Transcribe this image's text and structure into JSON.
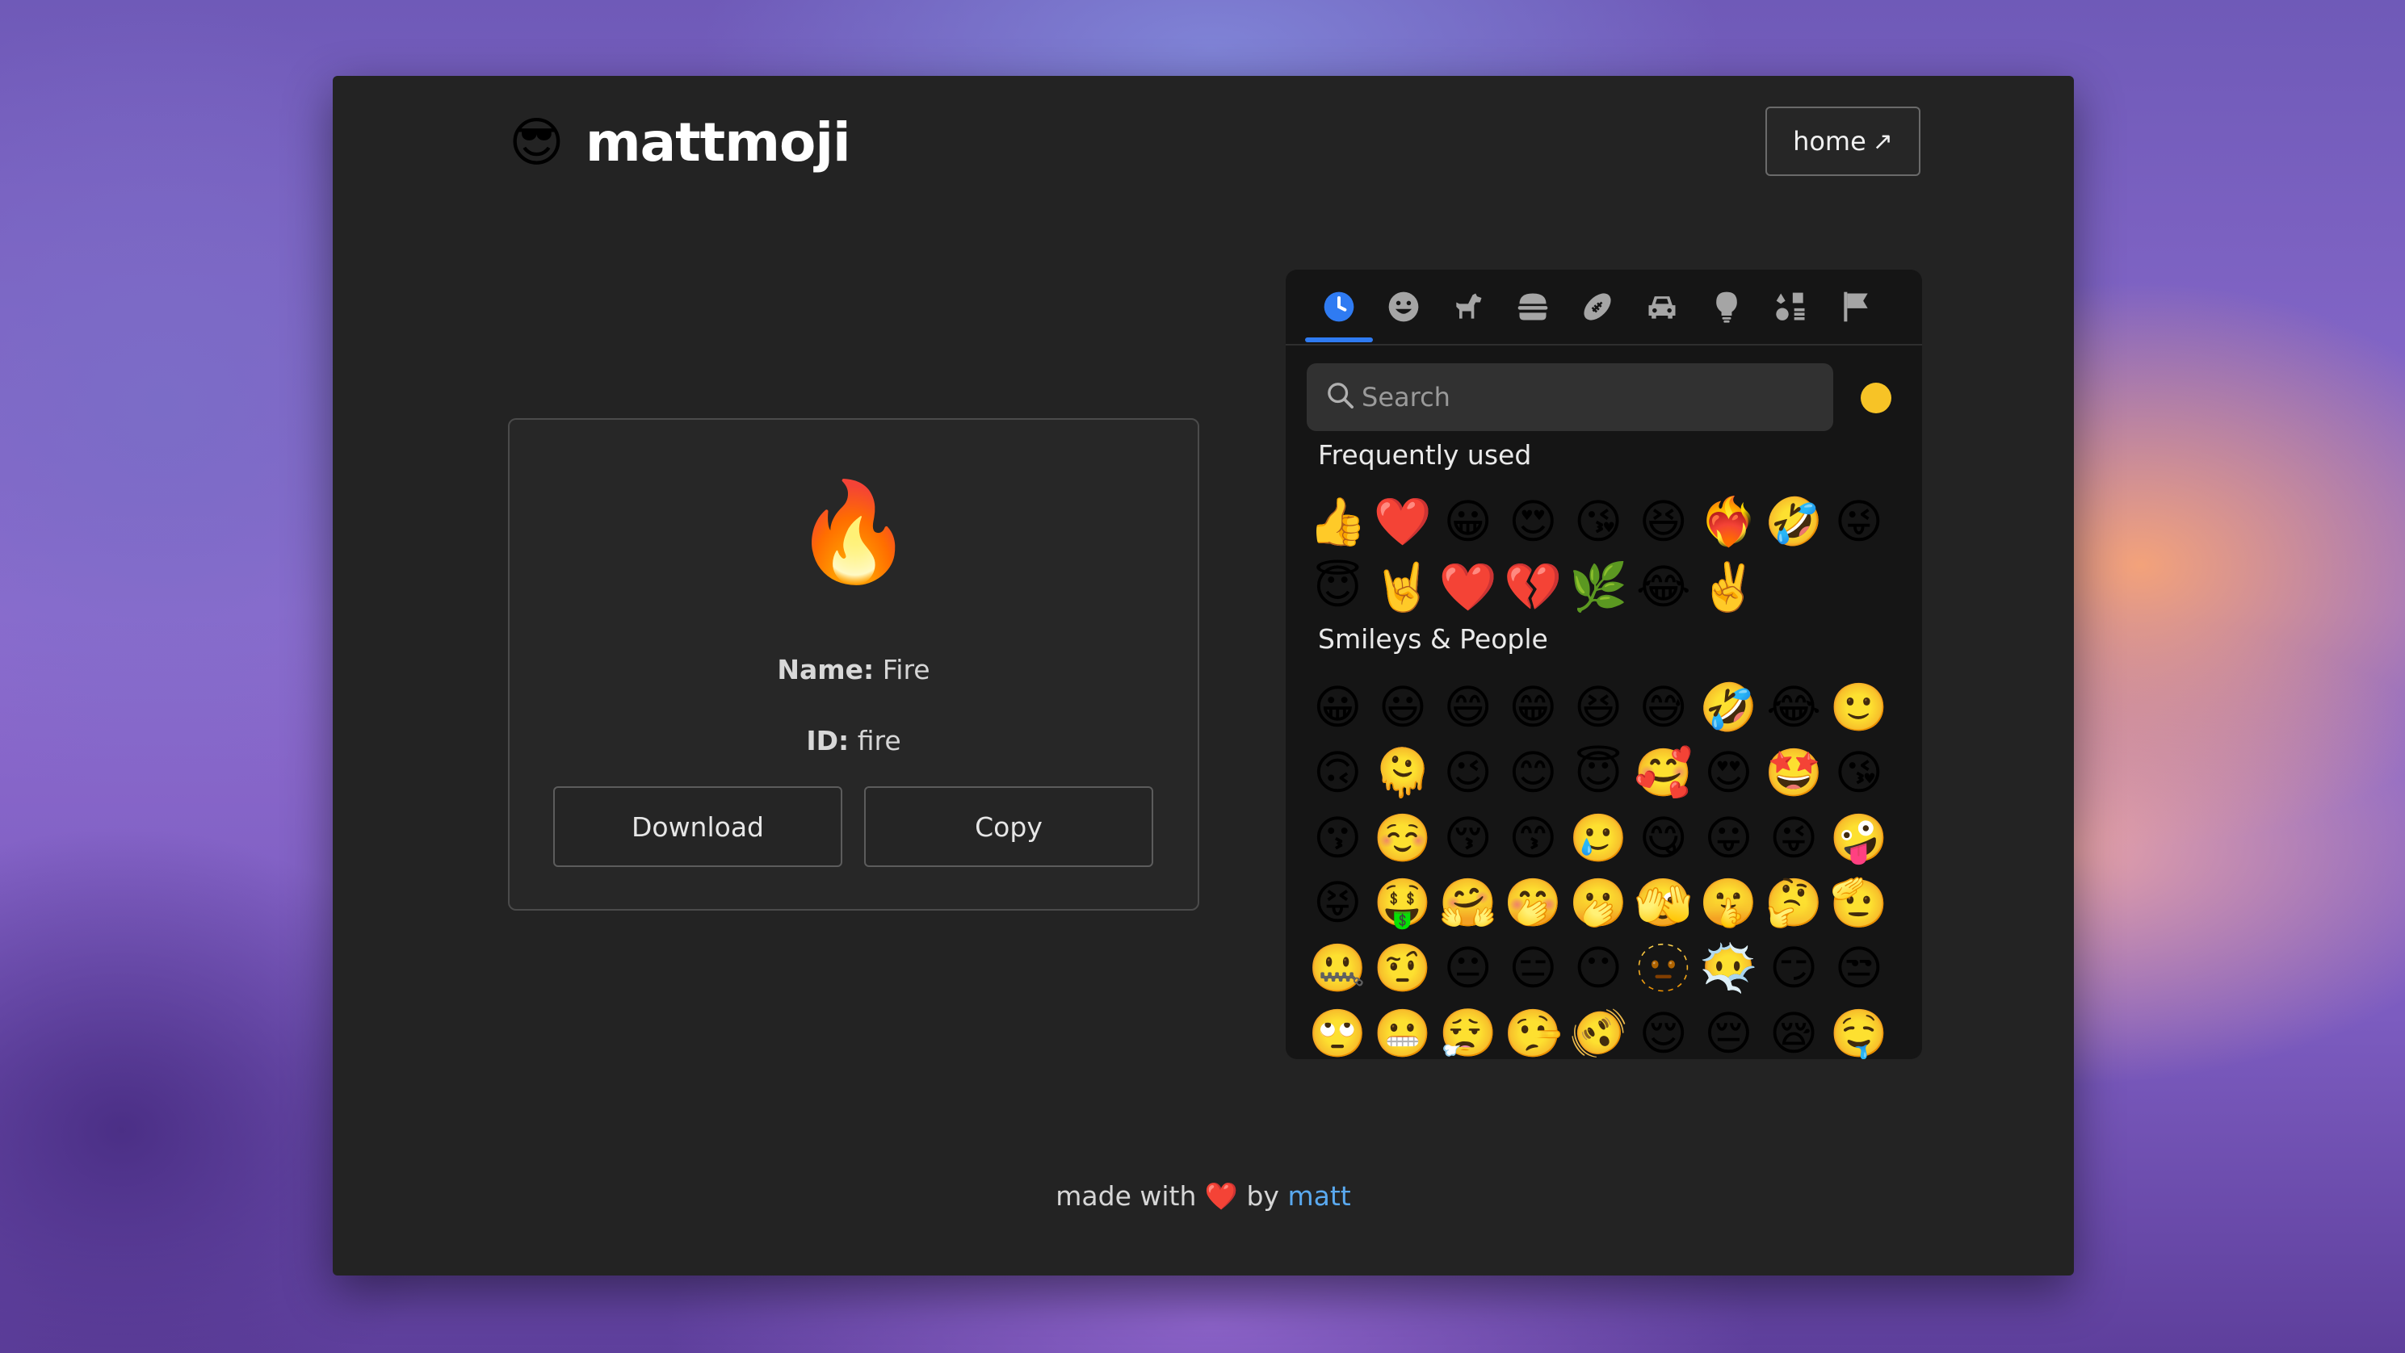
{
  "header": {
    "logo_emoji": "😎",
    "title": "mattmoji",
    "home_label": "home",
    "home_arrow": "↗"
  },
  "detail": {
    "emoji": "🔥",
    "name_label": "Name:",
    "name_value": "Fire",
    "id_label": "ID:",
    "id_value": "fire",
    "download_label": "Download",
    "copy_label": "Copy"
  },
  "picker": {
    "tabs": [
      {
        "name": "clock-icon",
        "active": true
      },
      {
        "name": "smiley-icon",
        "active": false
      },
      {
        "name": "dog-icon",
        "active": false
      },
      {
        "name": "burger-icon",
        "active": false
      },
      {
        "name": "football-icon",
        "active": false
      },
      {
        "name": "car-icon",
        "active": false
      },
      {
        "name": "lightbulb-icon",
        "active": false
      },
      {
        "name": "symbols-icon",
        "active": false
      },
      {
        "name": "flag-icon",
        "active": false
      }
    ],
    "accent_color": "#2f7bf2",
    "search_placeholder": "Search",
    "skin_tone_color": "#f7c326",
    "frequent_title": "Frequently used",
    "frequent": [
      "👍",
      "❤️",
      "😀",
      "😍",
      "😘",
      "😆",
      "❤️‍🔥",
      "🤣",
      "😜",
      "😇",
      "🤘",
      "❤️",
      "💔",
      "🌿",
      "😂",
      "✌️"
    ],
    "smileys_title": "Smileys & People",
    "smileys": [
      "😀",
      "😃",
      "😄",
      "😁",
      "😆",
      "😅",
      "🤣",
      "😂",
      "🙂",
      "🙃",
      "🫠",
      "😉",
      "😊",
      "😇",
      "🥰",
      "😍",
      "🤩",
      "😘",
      "😗",
      "☺️",
      "😚",
      "😙",
      "🥲",
      "😋",
      "😛",
      "😜",
      "🤪",
      "😝",
      "🤑",
      "🤗",
      "🤭",
      "🫢",
      "🫣",
      "🤫",
      "🤔",
      "🫡",
      "🤐",
      "🤨",
      "😐",
      "😑",
      "😶",
      "🫥",
      "😶‍🌫️",
      "😏",
      "😒",
      "🙄",
      "😬",
      "😮‍💨",
      "🤥",
      "🫨",
      "😌",
      "😔",
      "😪",
      "🤤"
    ]
  },
  "footer": {
    "prefix": "made with",
    "heart": "❤️",
    "by": "by",
    "author": "matt"
  }
}
